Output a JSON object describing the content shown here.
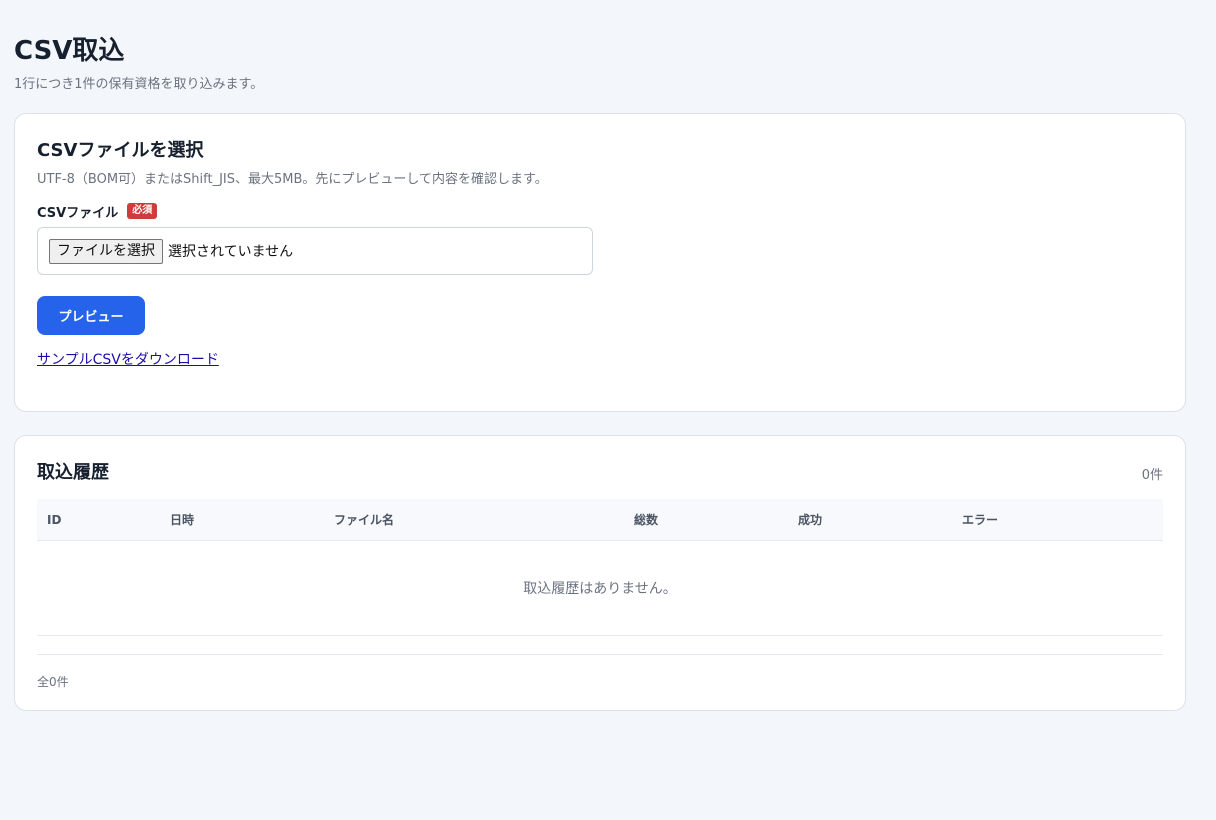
{
  "page": {
    "title": "CSV取込",
    "subtitle": "1行につき1件の保有資格を取り込みます。"
  },
  "upload": {
    "title": "CSVファイルを選択",
    "description": "UTF-8（BOM可）またはShift_JIS、最大5MB。先にプレビューして内容を確認します。",
    "field_label": "CSVファイル",
    "required_badge": "必須",
    "file_button_label": "ファイルを選択",
    "file_status": "選択されていません",
    "preview_button": "プレビュー",
    "sample_link": "サンプルCSVをダウンロード"
  },
  "history": {
    "title": "取込履歴",
    "count": "0件",
    "columns": [
      "ID",
      "日時",
      "ファイル名",
      "総数",
      "成功",
      "エラー"
    ],
    "empty_message": "取込履歴はありません。",
    "total": "全0件"
  },
  "colors": {
    "accent": "#2563eb",
    "required": "#d03b3b",
    "background": "#f3f6fa"
  }
}
